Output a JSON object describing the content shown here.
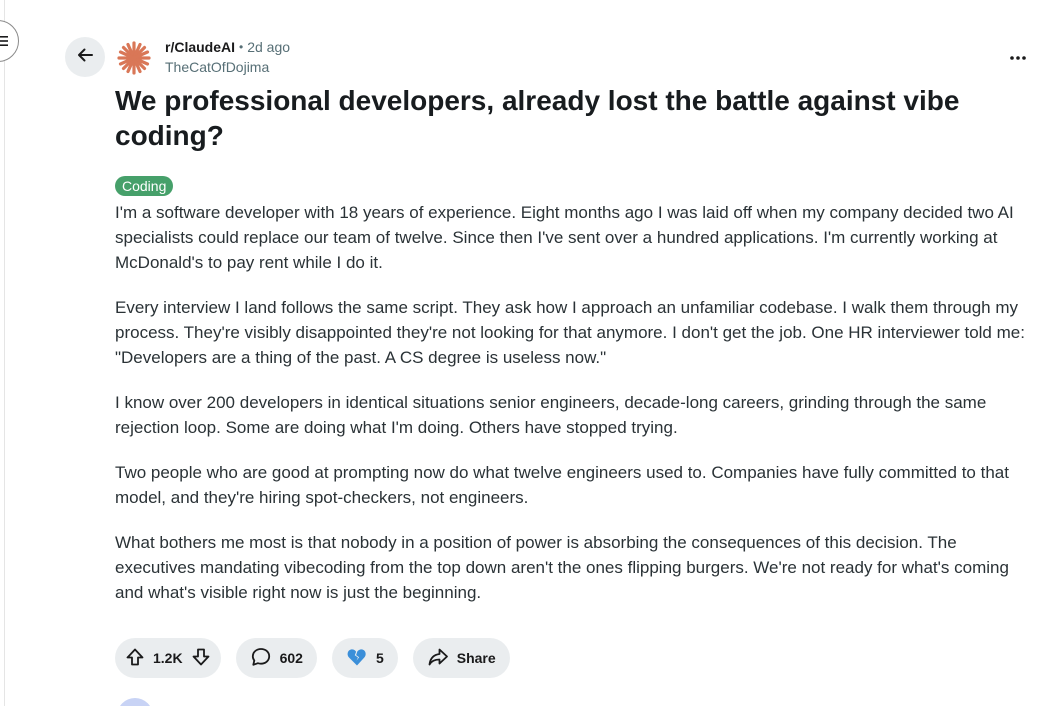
{
  "post": {
    "subreddit": "r/ClaudeAI",
    "separator": "•",
    "time": "2d ago",
    "author": "TheCatOfDojima",
    "title": "We professional developers, already lost the battle against vibe coding?",
    "flair": "Coding",
    "flair_color": "#46a06a",
    "paragraphs": [
      "I'm a software developer with 18 years of experience. Eight months ago I was laid off when my company decided two AI specialists could replace our team of twelve. Since then I've sent over a hundred applications. I'm currently working at McDonald's to pay rent while I do it.",
      "Every interview I land follows the same script. They ask how I approach an unfamiliar codebase. I walk them through my process. They're visibly disappointed they're not looking for that anymore. I don't get the job. One HR interviewer told me: \"Developers are a thing of the past. A CS degree is useless now.\"",
      "I know over 200 developers in identical situations senior engineers, decade-long careers, grinding through the same rejection loop. Some are doing what I'm doing. Others have stopped trying.",
      "Two people who are good at prompting now do what twelve engineers used to. Companies have fully committed to that model, and they're hiring spot-checkers, not engineers.",
      "What bothers me most is that nobody in a position of power is absorbing the consequences of this decision. The executives mandating vibecoding from the top down aren't the ones flipping burgers. We're not ready for what's coming and what's visible right now is just the beginning."
    ]
  },
  "actions": {
    "votes": "1.2K",
    "comments": "602",
    "awards": "5",
    "share_label": "Share"
  },
  "icons": {
    "menu": "menu-icon",
    "back": "arrow-left-icon",
    "avatar": "claude-logo-icon",
    "more": "more-horizontal-icon",
    "upvote": "upvote-arrow-icon",
    "downvote": "downvote-arrow-icon",
    "comment": "comment-bubble-icon",
    "award": "broken-heart-icon",
    "share": "share-arrow-icon"
  },
  "colors": {
    "accent_claude": "#d97757",
    "award_blue": "#3b8fd9"
  }
}
